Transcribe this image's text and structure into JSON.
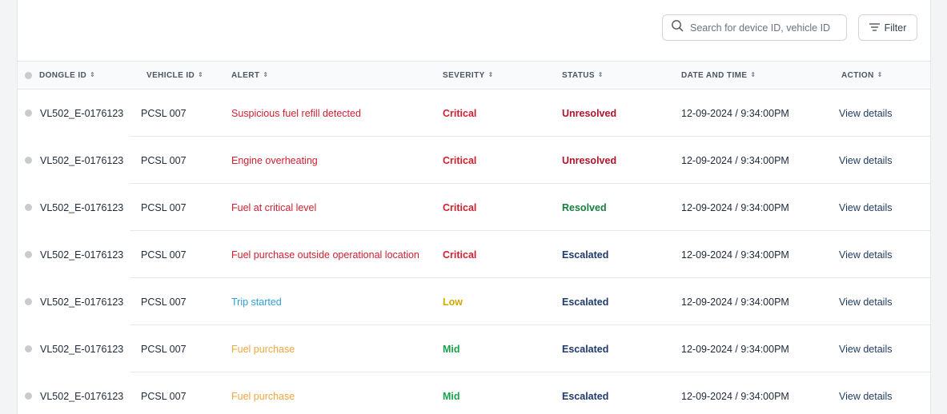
{
  "search": {
    "placeholder": "Search for device ID, vehicle ID",
    "icon": "search-icon"
  },
  "filter": {
    "label": "Filter",
    "icon": "filter-lines-icon"
  },
  "colors": {
    "critical": "#d11f2e",
    "low": "#d4a700",
    "mid": "#16a34a",
    "unresolved": "#b0142a",
    "resolved": "#15803d",
    "escalated": "#1e3a6b",
    "alert_red": "#d11f2e",
    "alert_blue": "#2b9fd8",
    "alert_orange": "#f0a640",
    "action": "#1e3a5f"
  },
  "columns": {
    "dongle": "DONGLE ID",
    "vehicle": "VEHICLE ID",
    "alert": "ALERT",
    "severity": "SEVERITY",
    "status": "STATUS",
    "datetime": "DATE AND TIME",
    "action": "ACTION"
  },
  "rows": [
    {
      "dongle": "VL502_E-0176123",
      "vehicle": "PCSL 007",
      "alert": "Suspicious fuel refill detected",
      "alert_color": "#d11f2e",
      "severity": "Critical",
      "severity_color": "#d11f2e",
      "status": "Unresolved",
      "status_color": "#b0142a",
      "datetime": "12-09-2024 / 9:34:00PM",
      "action": "View details"
    },
    {
      "dongle": "VL502_E-0176123",
      "vehicle": "PCSL 007",
      "alert": "Engine overheating",
      "alert_color": "#d11f2e",
      "severity": "Critical",
      "severity_color": "#d11f2e",
      "status": "Unresolved",
      "status_color": "#b0142a",
      "datetime": "12-09-2024 / 9:34:00PM",
      "action": "View details"
    },
    {
      "dongle": "VL502_E-0176123",
      "vehicle": "PCSL 007",
      "alert": "Fuel at critical level",
      "alert_color": "#d11f2e",
      "severity": "Critical",
      "severity_color": "#d11f2e",
      "status": "Resolved",
      "status_color": "#15803d",
      "datetime": "12-09-2024 / 9:34:00PM",
      "action": "View details"
    },
    {
      "dongle": "VL502_E-0176123",
      "vehicle": "PCSL 007",
      "alert": "Fuel purchase outside operational location",
      "alert_color": "#d11f2e",
      "severity": "Critical",
      "severity_color": "#d11f2e",
      "status": "Escalated",
      "status_color": "#1e3a6b",
      "datetime": "12-09-2024 / 9:34:00PM",
      "action": "View details"
    },
    {
      "dongle": "VL502_E-0176123",
      "vehicle": "PCSL 007",
      "alert": "Trip started",
      "alert_color": "#2b9fd8",
      "severity": "Low",
      "severity_color": "#d4a700",
      "status": "Escalated",
      "status_color": "#1e3a6b",
      "datetime": "12-09-2024 / 9:34:00PM",
      "action": "View details"
    },
    {
      "dongle": "VL502_E-0176123",
      "vehicle": "PCSL 007",
      "alert": "Fuel purchase",
      "alert_color": "#f0a640",
      "severity": "Mid",
      "severity_color": "#16a34a",
      "status": "Escalated",
      "status_color": "#1e3a6b",
      "datetime": "12-09-2024 / 9:34:00PM",
      "action": "View details"
    },
    {
      "dongle": "VL502_E-0176123",
      "vehicle": "PCSL 007",
      "alert": "Fuel purchase",
      "alert_color": "#f0a640",
      "severity": "Mid",
      "severity_color": "#16a34a",
      "status": "Escalated",
      "status_color": "#1e3a6b",
      "datetime": "12-09-2024 / 9:34:00PM",
      "action": "View details"
    }
  ]
}
